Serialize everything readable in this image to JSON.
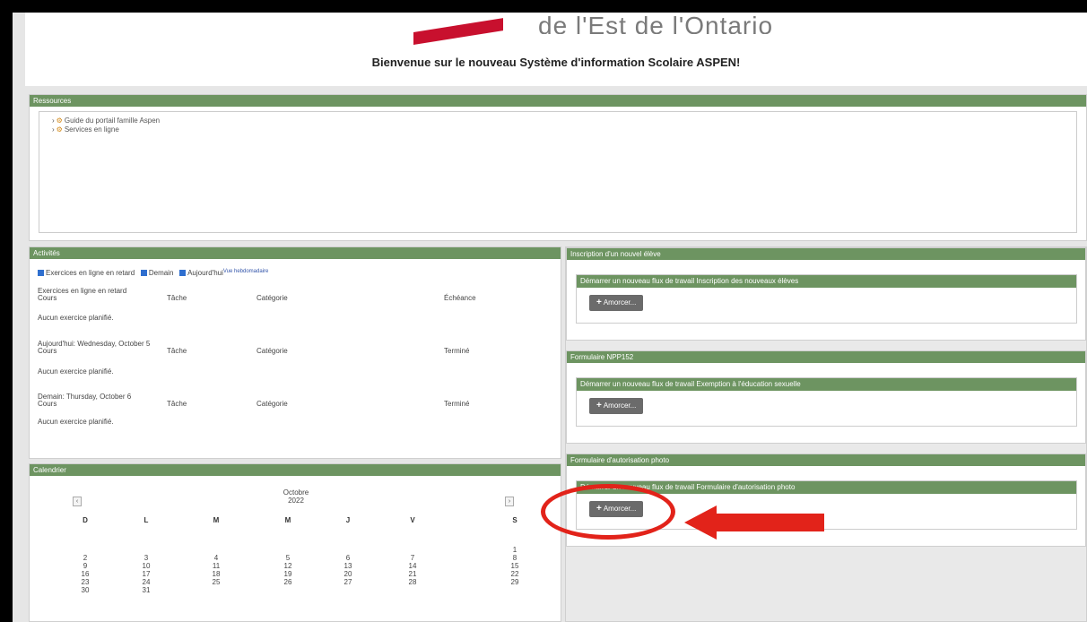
{
  "banner": {
    "logo_text": "de l'Est de l'Ontario",
    "welcome": "Bienvenue sur le nouveau Système d'information Scolaire ASPEN!"
  },
  "ressources": {
    "title": "Ressources",
    "items": [
      "Guide du portail famille Aspen",
      "Services en ligne"
    ]
  },
  "activities": {
    "title": "Activités",
    "filters": [
      {
        "label": "Exercices en ligne en retard",
        "checked": true
      },
      {
        "label": "Demain",
        "checked": true
      },
      {
        "label": "Aujourd'hui",
        "checked": true
      }
    ],
    "link": "Vue hebdomadaire",
    "sections": [
      {
        "title": "Exercices en ligne en retard",
        "cols": [
          "Cours",
          "Tâche",
          "Catégorie",
          "Échéance"
        ],
        "empty": "Aucun exercice planifié."
      },
      {
        "title": "Aujourd'hui: Wednesday, October 5",
        "cols": [
          "Cours",
          "Tâche",
          "Catégorie",
          "Terminé"
        ],
        "empty": "Aucun exercice planifié."
      },
      {
        "title": "Demain: Thursday, October 6",
        "cols": [
          "Cours",
          "Tâche",
          "Catégorie",
          "Terminé"
        ],
        "empty": "Aucun exercice planifié."
      }
    ]
  },
  "calendar": {
    "title": "Calendrier",
    "month": "Octobre",
    "year": "2022",
    "prev": "‹",
    "next": "›",
    "days_of_week": [
      "D",
      "L",
      "M",
      "M",
      "J",
      "V",
      "S"
    ],
    "weeks": [
      [
        "",
        "",
        "",
        "",
        "",
        "",
        "1"
      ],
      [
        "2",
        "3",
        "4",
        "5",
        "6",
        "7",
        "8"
      ],
      [
        "9",
        "10",
        "11",
        "12",
        "13",
        "14",
        "15"
      ],
      [
        "16",
        "17",
        "18",
        "19",
        "20",
        "21",
        "22"
      ],
      [
        "23",
        "24",
        "25",
        "26",
        "27",
        "28",
        "29"
      ],
      [
        "30",
        "31",
        "",
        "",
        "",
        "",
        ""
      ]
    ]
  },
  "forms": [
    {
      "title": "Inscription d'un nouvel élève",
      "subtitle": "Démarrer un nouveau flux de travail Inscription des nouveaux élèves",
      "button": "Amorcer..."
    },
    {
      "title": "Formulaire NPP152",
      "subtitle": "Démarrer un nouveau flux de travail Exemption à l'éducation sexuelle",
      "button": "Amorcer..."
    },
    {
      "title": "Formulaire d'autorisation photo",
      "subtitle": "Démarrer un nouveau flux de travail Formulaire d'autorisation photo",
      "button": "Amorcer..."
    }
  ],
  "colors": {
    "header_green": "#6d9461",
    "annotation_red": "#e2231a",
    "button_gray": "#6b6b6b"
  }
}
